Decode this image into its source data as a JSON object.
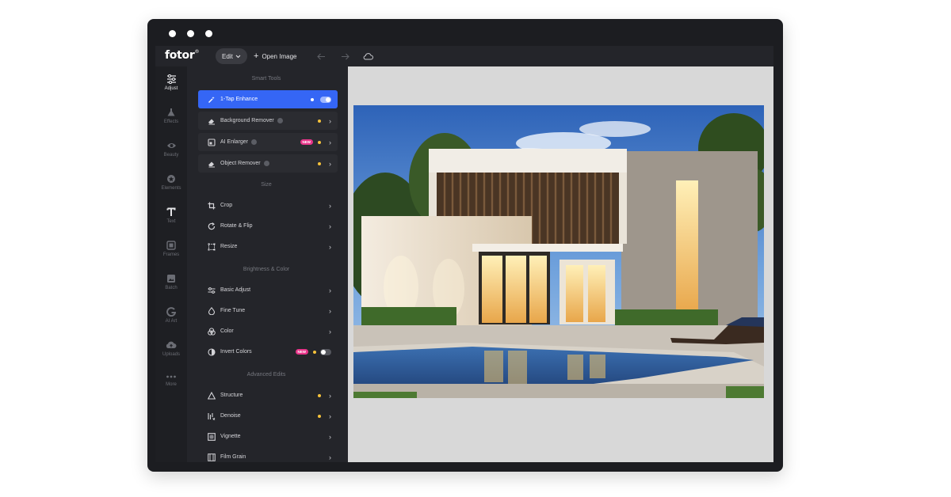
{
  "app": {
    "logo": "fotor",
    "logo_mark": "®",
    "edit_label": "Edit",
    "open_image_label": "Open Image"
  },
  "rail": [
    {
      "label": "Adjust",
      "icon": "sliders-icon",
      "active": true
    },
    {
      "label": "Effects",
      "icon": "flask-icon"
    },
    {
      "label": "Beauty",
      "icon": "eye-icon"
    },
    {
      "label": "Elements",
      "icon": "shapes-icon"
    },
    {
      "label": "Text",
      "icon": "text-icon"
    },
    {
      "label": "Frames",
      "icon": "frame-icon"
    },
    {
      "label": "Batch",
      "icon": "batch-icon"
    },
    {
      "label": "AI Art",
      "icon": "ai-art-icon"
    },
    {
      "label": "Uploads",
      "icon": "cloud-upload-icon"
    },
    {
      "label": "More",
      "icon": "more-icon"
    }
  ],
  "panel": {
    "sections": [
      {
        "title": "Smart Tools"
      },
      {
        "title": "Size"
      },
      {
        "title": "Brightness & Color"
      },
      {
        "title": "Advanced Edits"
      }
    ],
    "smart_tools": [
      {
        "label": "1-Tap Enhance",
        "icon": "magic-wand-icon",
        "active": true,
        "toggle": "on"
      },
      {
        "label": "Background Remover",
        "icon": "eraser-icon",
        "help": true,
        "premium": true
      },
      {
        "label": "AI Enlarger",
        "icon": "enlarge-icon",
        "help": true,
        "badge": "NEW",
        "premium": true
      },
      {
        "label": "Object Remover",
        "icon": "eraser-icon",
        "help": true,
        "premium": true
      }
    ],
    "size": [
      {
        "label": "Crop",
        "icon": "crop-icon"
      },
      {
        "label": "Rotate & Flip",
        "icon": "rotate-icon"
      },
      {
        "label": "Resize",
        "icon": "resize-icon"
      }
    ],
    "brightness": [
      {
        "label": "Basic Adjust",
        "icon": "sliders-icon"
      },
      {
        "label": "Fine Tune",
        "icon": "droplet-icon"
      },
      {
        "label": "Color",
        "icon": "color-icon"
      },
      {
        "label": "Invert Colors",
        "icon": "invert-icon",
        "badge": "NEW",
        "premium": true,
        "toggle": "off"
      }
    ],
    "advanced": [
      {
        "label": "Structure",
        "icon": "triangle-icon",
        "premium": true
      },
      {
        "label": "Denoise",
        "icon": "denoise-icon",
        "premium": true
      },
      {
        "label": "Vignette",
        "icon": "vignette-icon"
      },
      {
        "label": "Film Grain",
        "icon": "film-grain-icon"
      }
    ]
  },
  "colors": {
    "accent": "#3566f5",
    "premium_dot": "#f7c33b",
    "new_badge": "#e8358a",
    "app_bg": "#24252a",
    "canvas_bg": "#d8d8d8"
  }
}
